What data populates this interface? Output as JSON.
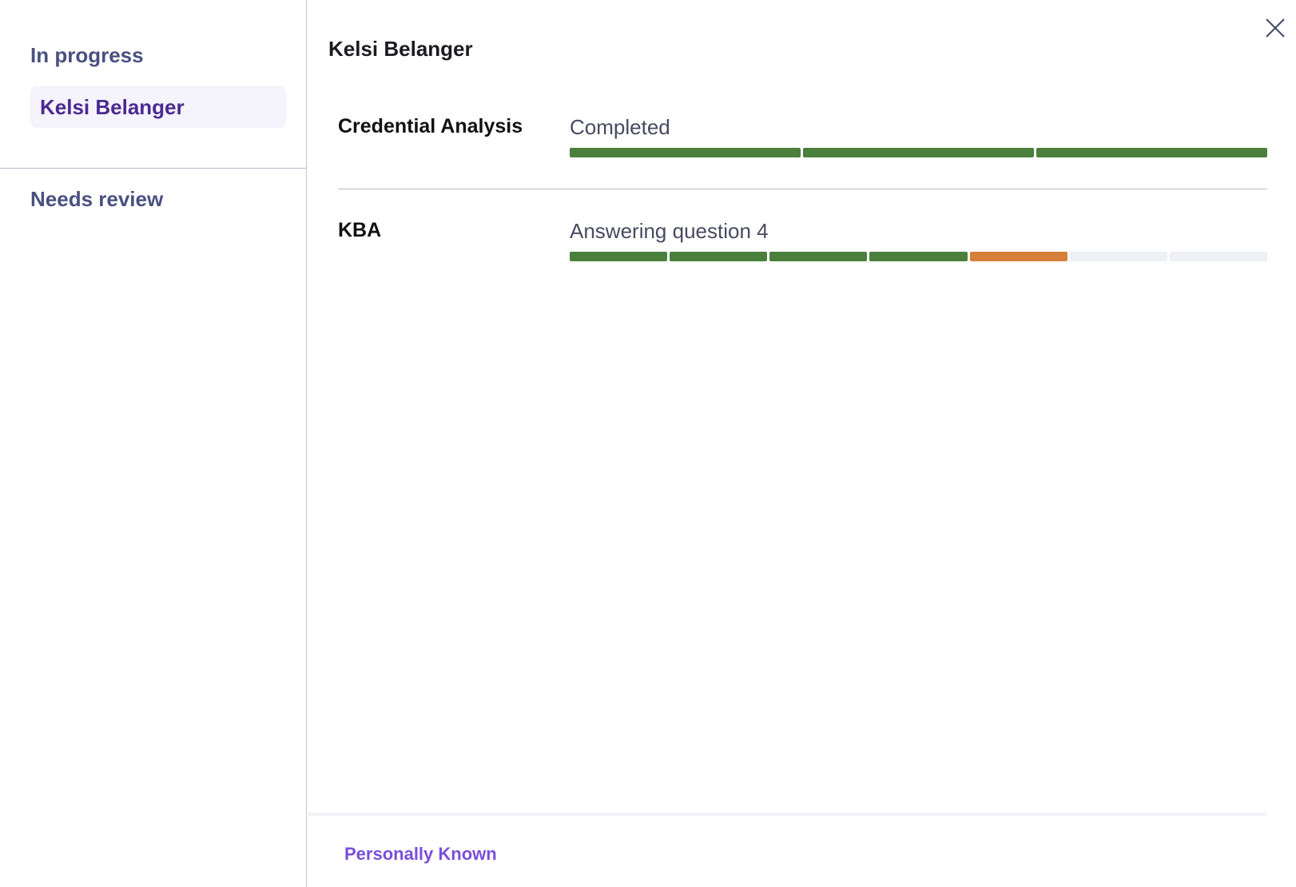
{
  "sidebar": {
    "in_progress_label": "In progress",
    "in_progress_items": [
      {
        "label": "Kelsi Belanger"
      }
    ],
    "needs_review_label": "Needs review"
  },
  "main": {
    "title": "Kelsi Belanger",
    "steps": [
      {
        "name": "Credential Analysis",
        "status": "Completed",
        "progress_segments": [
          "done",
          "done",
          "done"
        ]
      },
      {
        "name": "KBA",
        "status": "Answering question 4",
        "progress_segments": [
          "done",
          "done",
          "done",
          "done",
          "active",
          "todo",
          "todo"
        ]
      }
    ],
    "footer_link": "Personally Known"
  },
  "icons": {
    "close": "close-icon"
  },
  "colors": {
    "done": "#4a7f3c",
    "active": "#d4803a",
    "todo": "#eff0f3",
    "accent": "#7a4fd8",
    "selected_text": "#4b2a8f"
  }
}
